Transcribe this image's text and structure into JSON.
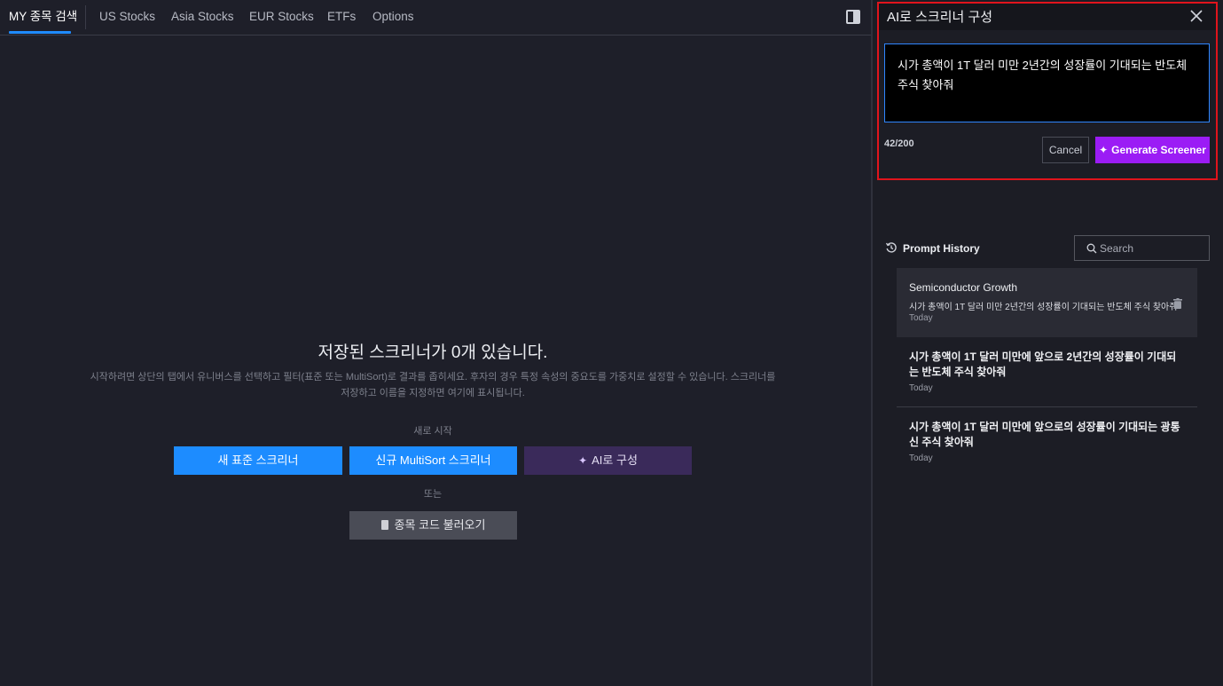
{
  "tabs": [
    {
      "label": "MY 종목 검색",
      "active": true
    },
    {
      "label": "US Stocks"
    },
    {
      "label": "Asia Stocks"
    },
    {
      "label": "EUR Stocks"
    },
    {
      "label": "ETFs"
    },
    {
      "label": "Options"
    }
  ],
  "empty_state": {
    "title": "저장된 스크리너가 0개 있습니다.",
    "description": "시작하려면 상단의 탭에서 유니버스를 선택하고 필터(표준 또는 MultiSort)로 결과를 좁히세요. 후자의 경우 특정 속성의 중요도를 가중치로 설정할 수 있습니다. 스크리너를 저장하고 이름을 지정하면 여기에 표시됩니다.",
    "start_label": "새로 시작",
    "new_standard_button": "새 표준 스크리너",
    "new_multisort_button": "신규 MultiSort 스크리너",
    "ai_button": "AI로 구성",
    "or_label": "또는",
    "import_button": "종목 코드 불러오기"
  },
  "ai_panel": {
    "title": "AI로 스크리너 구성",
    "prompt_value": "시가 총액이 1T 달러 미만 2년간의 성장률이 기대되는  반도체 주식 찾아줘",
    "char_count": "42/200",
    "cancel_label": "Cancel",
    "generate_label": "Generate Screener"
  },
  "history": {
    "title": "Prompt History",
    "search_placeholder": "Search",
    "items": [
      {
        "name": "Semiconductor Growth",
        "prompt": "시가 총액이 1T 달러 미만 2년간의 성장률이 기대되는 반도체 주식 찾아줘",
        "date": "Today"
      },
      {
        "prompt": "시가 총액이 1T 달러 미만에 앞으로 2년간의 성장률이 기대되는 반도체 주식 찾아줘",
        "date": "Today"
      },
      {
        "prompt": "시가 총액이 1T 달러 미만에 앞으로의 성장률이 기대되는 광통신 주식 찾아줘",
        "date": "Today"
      }
    ]
  },
  "colors": {
    "accent_blue": "#1d8cff",
    "generate_purple": "#9b1cf5",
    "highlight_red": "#e0141c"
  }
}
